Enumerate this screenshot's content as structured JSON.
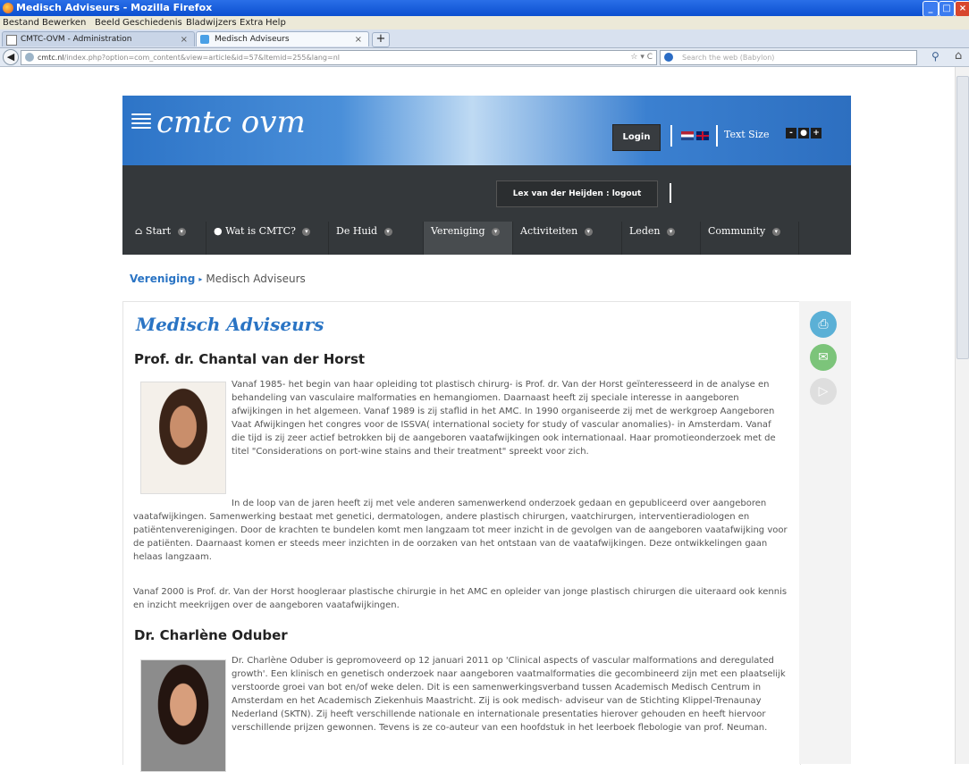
{
  "window": {
    "title": "Medisch Adviseurs - Mozilla Firefox",
    "controls": [
      "_",
      "□",
      "×"
    ]
  },
  "menu": [
    "Bestand",
    "Bewerken",
    "Beeld",
    "Geschiedenis",
    "Bladwijzers",
    "Extra",
    "Help"
  ],
  "tabs": [
    {
      "label": "CMTC-OVM - Administration",
      "close": "×"
    },
    {
      "label": "Medisch Adviseurs",
      "close": "×"
    }
  ],
  "new_tab": "+",
  "address": {
    "domain": "cmtc.nl",
    "path": "/index.php?option=com_content&view=article&id=57&Itemid=255&lang=nl",
    "controls": "☆ ▾ C"
  },
  "search": {
    "placeholder": "Search the web (Babylon)"
  },
  "site": {
    "logo": "cmtc ovm",
    "login": "Login",
    "text_size_label": "Text Size",
    "text_size_buttons": [
      "-",
      "●",
      "+"
    ],
    "user_status": "Lex van der Heijden : logout"
  },
  "nav": [
    {
      "label": "Start",
      "icon": "home-icon"
    },
    {
      "label": "Wat is CMTC?",
      "icon": "info-icon"
    },
    {
      "label": "De Huid"
    },
    {
      "label": "Vereniging",
      "active": true
    },
    {
      "label": "Activiteiten"
    },
    {
      "label": "Leden"
    },
    {
      "label": "Community"
    }
  ],
  "breadcrumb": {
    "parent": "Vereniging",
    "separator": "▸",
    "current": "Medisch Adviseurs"
  },
  "article": {
    "title": "Medisch Adviseurs",
    "people": [
      {
        "name": "Prof. dr. Chantal van der Horst",
        "p1": "Vanaf 1985- het begin van haar opleiding tot plastisch chirurg- is Prof. dr. Van der Horst geïnteresseerd in de analyse en behandeling van vasculaire malformaties en hemangiomen. Daarnaast heeft zij speciale interesse in aangeboren afwijkingen in het algemeen. Vanaf 1989 is zij staflid in het AMC. In 1990 organiseerde zij met de werkgroep Aangeboren Vaat Afwijkingen het congres voor de ISSVA( international society for study of vascular anomalies)- in Amsterdam. Vanaf die tijd is zij zeer actief betrokken bij de aangeboren vaatafwijkingen ook internationaal. Haar promotieonderzoek met de titel \"Considerations on port-wine stains and their treatment\" spreekt voor zich.",
        "p2": "In de loop van de jaren heeft zij met vele anderen samenwerkend onderzoek gedaan en gepubliceerd over aangeboren vaatafwijkingen. Samenwerking bestaat met genetici, dermatologen, andere plastisch chirurgen, vaatchirurgen, interventieradiologen en patiëntenverenigingen. Door de krachten te bundelen komt men langzaam tot meer inzicht in de gevolgen van de aangeboren vaatafwijking voor de patiënten. Daarnaast komen er steeds meer inzichten in de oorzaken van het ontstaan van de vaatafwijkingen. Deze ontwikkelingen gaan helaas langzaam.",
        "p3": "Vanaf 2000 is Prof. dr. Van der Horst hoogleraar plastische chirurgie in het AMC en opleider van jonge plastisch chirurgen die uiteraard ook kennis en inzicht meekrijgen over de aangeboren vaatafwijkingen."
      },
      {
        "name": "Dr. Charlène Oduber",
        "p1": "Dr. Charlène Oduber is gepromoveerd op 12 januari 2011 op 'Clinical aspects of vascular malformations and deregulated growth'. Een klinisch en genetisch onderzoek naar aangeboren vaatmalformaties die gecombineerd zijn met een plaatselijk verstoorde groei van bot en/of weke delen. Dit is een samenwerkingsverband tussen Academisch Medisch Centrum in Amsterdam en het Academisch Ziekenhuis Maastricht. Zij is ook medisch- adviseur van de Stichting Klippel-Trenaunay Nederland (SKTN). Zij heeft verschillende nationale en internationale presentaties hierover gehouden en heeft hiervoor verschillende prijzen gewonnen. Tevens is ze co-auteur van een hoofdstuk in het leerboek flebologie van prof. Neuman."
      }
    ]
  },
  "tools": [
    {
      "name": "print",
      "glyph": "⎙"
    },
    {
      "name": "email",
      "glyph": "✉"
    },
    {
      "name": "pdf",
      "glyph": "▷"
    }
  ]
}
